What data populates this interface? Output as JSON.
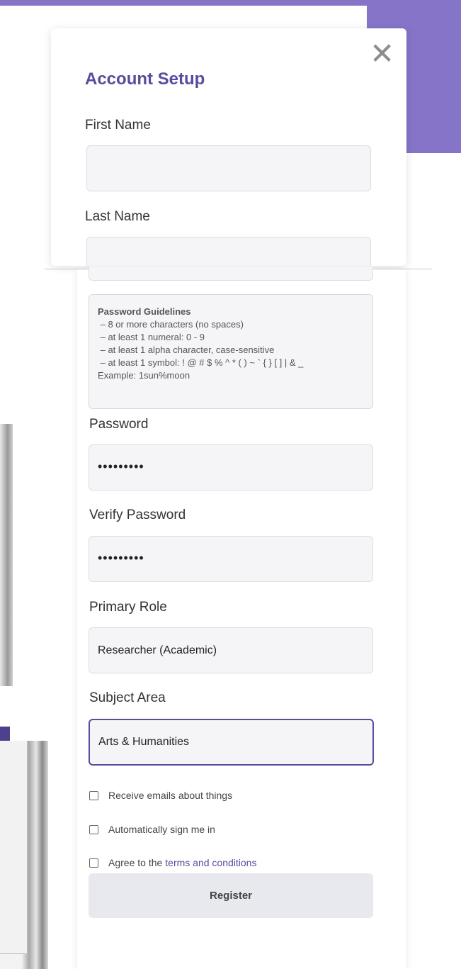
{
  "dialog": {
    "title": "Account Setup",
    "close_icon": "close-icon",
    "close_glyph": "✕"
  },
  "fields": {
    "first_name_label": "First Name",
    "first_name_value": "",
    "last_name_label": "Last Name",
    "last_name_value": "",
    "password_label": "Password",
    "password_value": "•••••••••",
    "verify_password_label": "Verify Password",
    "verify_password_value": "•••••••••",
    "primary_role_label": "Primary Role",
    "primary_role_value": "Researcher (Academic)",
    "subject_area_label": "Subject Area",
    "subject_area_value": "Arts & Humanities"
  },
  "guidelines": {
    "title": "Password Guidelines",
    "lines": [
      " – 8 or more characters (no spaces)",
      " – at least 1 numeral: 0 - 9",
      " – at least 1 alpha character, case-sensitive",
      " – at least 1 symbol: ! @ # $ % ^ * ( ) ~ ` { } [ ] | & _"
    ],
    "example": "Example: 1sun%moon"
  },
  "checkboxes": {
    "emails": "Receive emails about things",
    "auto_sign_in": "Automatically sign me in",
    "agree_prefix": "Agree to the",
    "agree_link": "terms and conditions"
  },
  "register_label": "Register",
  "colors": {
    "accent": "#5b4a9e",
    "banner": "#8674c8"
  }
}
